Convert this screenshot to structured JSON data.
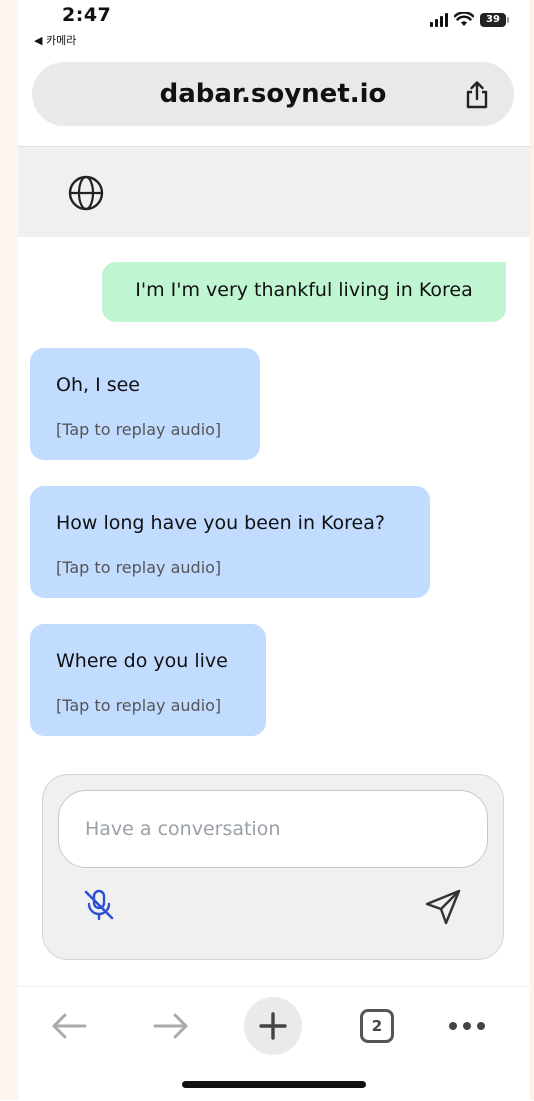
{
  "status_bar": {
    "time": "2:47",
    "back_app": "◀ 카메라",
    "battery": "39"
  },
  "browser": {
    "url": "dabar.soynet.io",
    "tab_count": "2"
  },
  "chat": {
    "user_messages": [
      {
        "text": "I'm I'm very thankful living in Korea"
      }
    ],
    "bot_messages": [
      {
        "text": "Oh, I see",
        "replay": "[Tap to replay audio]"
      },
      {
        "text": "How long have you been in Korea?",
        "replay": "[Tap to replay audio]"
      },
      {
        "text": "Where do you live",
        "replay": "[Tap to replay audio]"
      }
    ],
    "input_placeholder": "Have a conversation"
  },
  "icons": {
    "share": "share-icon",
    "globe": "globe-icon",
    "mic": "mic-off-icon",
    "send": "send-icon",
    "back": "arrow-left-icon",
    "forward": "arrow-right-icon",
    "new_tab": "plus-icon",
    "more": "more-icon"
  },
  "colors": {
    "user_bubble": "#bff5d1",
    "bot_bubble": "#c2dcff",
    "mic_icon": "#2d4fd6"
  }
}
